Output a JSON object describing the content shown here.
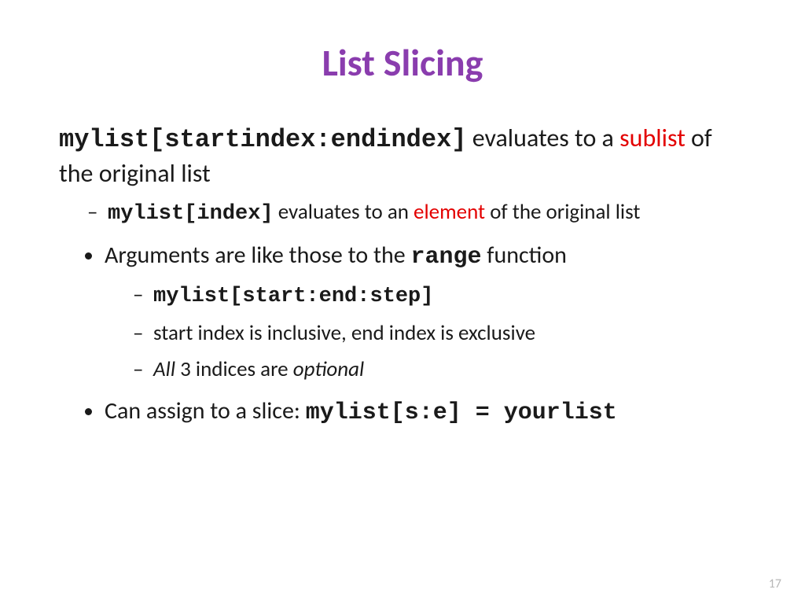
{
  "title": "List Slicing",
  "intro": {
    "code": "mylist[startindex:endindex]",
    "text1": " evaluates to a ",
    "highlight": "sublist",
    "text2": " of the original list"
  },
  "sub_intro": {
    "code": "mylist[index]",
    "text1": " evaluates to an ",
    "highlight": "element",
    "text2": " of the original list"
  },
  "bullet_args": {
    "text1": "Arguments are like those to the ",
    "code": "range",
    "text2": " function"
  },
  "sub_args": {
    "code": "mylist[start:end:step]",
    "inclusive": "start index is inclusive, end index is exclusive",
    "all": "All",
    "mid": " 3 indices are ",
    "optional": "optional"
  },
  "bullet_assign": {
    "text1": "Can assign to a slice: ",
    "code": "mylist[s:e] = yourlist"
  },
  "pagenum": "17"
}
